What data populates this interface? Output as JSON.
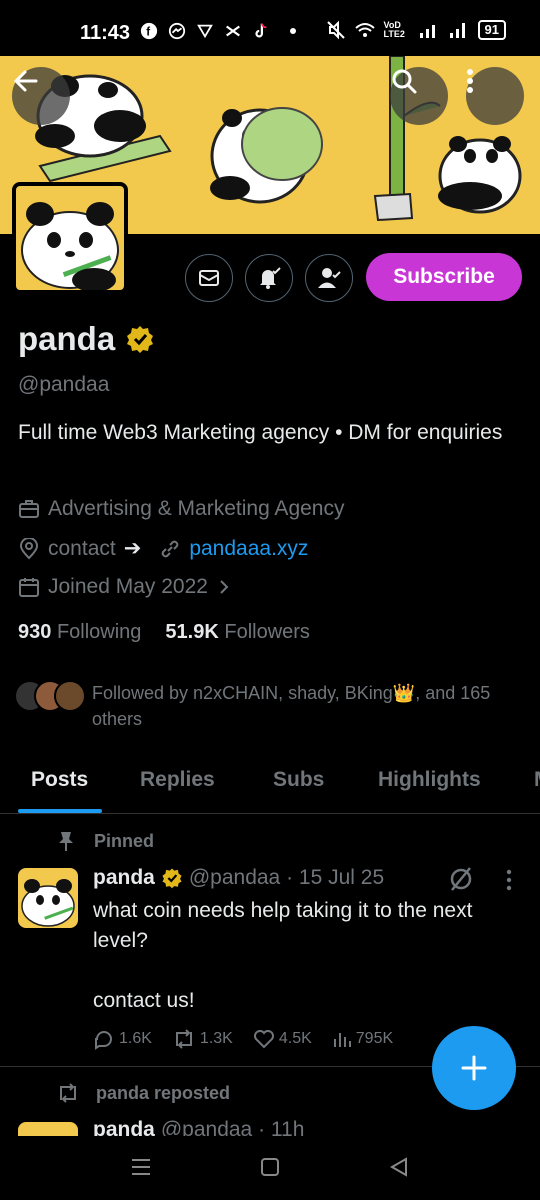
{
  "status_bar": {
    "time": "11:43",
    "lte": "VoD LTE2",
    "battery": "91"
  },
  "profile": {
    "name": "panda",
    "handle": "@pandaa",
    "bio": "Full time Web3 Marketing agency • DM for enquiries",
    "category": "Advertising & Marketing Agency",
    "contact_label": "contact",
    "contact_arrow": "➔",
    "website": "pandaaa.xyz",
    "joined": "Joined May 2022",
    "following_count": "930",
    "following_label": "Following",
    "followers_count": "51.9K",
    "followers_label": "Followers",
    "followed_by": "Followed by n2xCHAIN, shady, BKing👑, and 165 others",
    "subscribe_label": "Subscribe"
  },
  "tabs": [
    {
      "label": "Posts",
      "active": true
    },
    {
      "label": "Replies",
      "active": false
    },
    {
      "label": "Subs",
      "active": false
    },
    {
      "label": "Highlights",
      "active": false
    },
    {
      "label": "M",
      "active": false
    }
  ],
  "pinned_post": {
    "pinned_label": "Pinned",
    "author": "panda",
    "handle_date": "@pandaa · 15 Jul 25",
    "text": "what coin needs help taking it to the next level?\n\ncontact us!",
    "replies": "1.6K",
    "reposts": "1.3K",
    "likes": "4.5K",
    "views": "795K"
  },
  "repost": {
    "repost_label": "panda reposted",
    "author": "panda",
    "handle_time": "@pandaa · 11h"
  },
  "colors": {
    "accent": "#1d9bf0",
    "subscribe": "#c936d6",
    "banner": "#f2c94c",
    "verified": "#e2b719"
  }
}
